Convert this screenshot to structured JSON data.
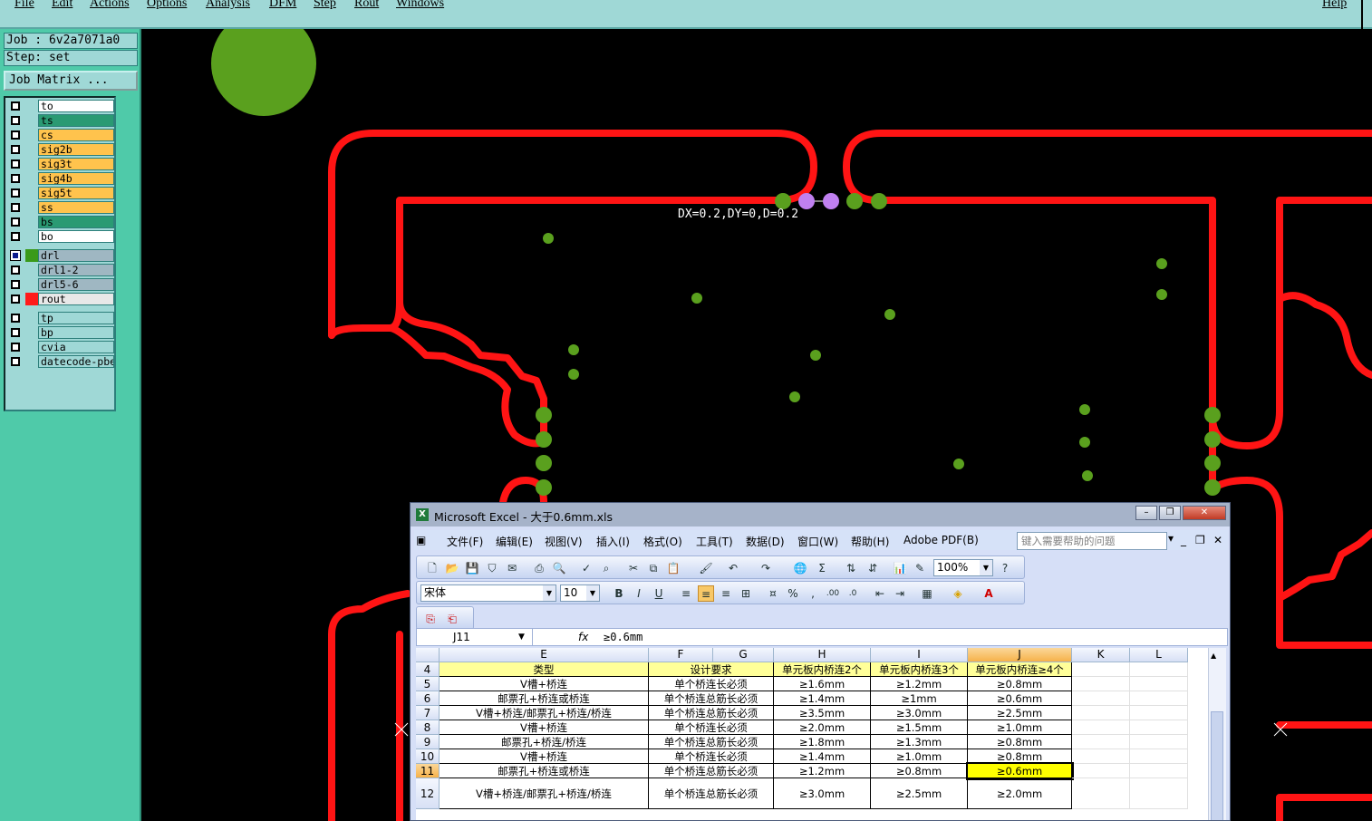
{
  "menubar": {
    "items": [
      "File",
      "Edit",
      "Actions",
      "Options",
      "Analysis",
      "DFM",
      "Step",
      "Rout",
      "Windows"
    ],
    "help": "Help"
  },
  "left_panel": {
    "job": "Job : 6v2a7071a0",
    "step": "Step: set",
    "job_matrix": "Job Matrix ...",
    "layers": [
      {
        "name": "to",
        "color": "#ffffff",
        "checked": false,
        "swatch": ""
      },
      {
        "name": "ts",
        "color": "#2a9a73",
        "checked": false,
        "swatch": ""
      },
      {
        "name": "cs",
        "color": "#ffc34d",
        "checked": false,
        "swatch": ""
      },
      {
        "name": "sig2b",
        "color": "#ffc34d",
        "checked": false,
        "swatch": ""
      },
      {
        "name": "sig3t",
        "color": "#ffc34d",
        "checked": false,
        "swatch": ""
      },
      {
        "name": "sig4b",
        "color": "#ffc34d",
        "checked": false,
        "swatch": ""
      },
      {
        "name": "sig5t",
        "color": "#ffc34d",
        "checked": false,
        "swatch": ""
      },
      {
        "name": "ss",
        "color": "#ffc34d",
        "checked": false,
        "swatch": ""
      },
      {
        "name": "bs",
        "color": "#2a9a73",
        "checked": false,
        "swatch": ""
      },
      {
        "name": "bo",
        "color": "#ffffff",
        "checked": false,
        "swatch": ""
      },
      {
        "name": "drl",
        "color": "#9fb7c2",
        "checked": true,
        "swatch": "#3a9a1a"
      },
      {
        "name": "drl1-2",
        "color": "#9fb7c2",
        "checked": false,
        "swatch": ""
      },
      {
        "name": "drl5-6",
        "color": "#9fb7c2",
        "checked": false,
        "swatch": ""
      },
      {
        "name": "rout",
        "color": "#e8e8e8",
        "checked": false,
        "swatch": "#ff1a1a"
      },
      {
        "name": "tp",
        "color": "#9fd8d6",
        "checked": false,
        "swatch": ""
      },
      {
        "name": "bp",
        "color": "#9fd8d6",
        "checked": false,
        "swatch": ""
      },
      {
        "name": "cvia",
        "color": "#9fd8d6",
        "checked": false,
        "swatch": ""
      },
      {
        "name": "datecode-pbe",
        "color": "#9fd8d6",
        "checked": false,
        "swatch": ""
      }
    ]
  },
  "canvas": {
    "measure_text": "DX=0.2,DY=0,D=0.2",
    "rout_color": "#ff1414",
    "drill_color": "#5aa01e",
    "measure_point_color": "#c080f0"
  },
  "excel": {
    "title": "Microsoft Excel - 大于0.6mm.xls",
    "menu": [
      "文件(F)",
      "编辑(E)",
      "视图(V)",
      "插入(I)",
      "格式(O)",
      "工具(T)",
      "数据(D)",
      "窗口(W)",
      "帮助(H)",
      "Adobe PDF(B)"
    ],
    "help_placeholder": "键入需要帮助的问题",
    "zoom": "100%",
    "font": "宋体",
    "font_size": "10",
    "name_box": "J11",
    "fx": "fx",
    "formula": "≥0.6mm",
    "columns": [
      "E",
      "F",
      "G",
      "H",
      "I",
      "J",
      "K",
      "L"
    ],
    "rows": [
      {
        "num": "4",
        "E": "类型",
        "F": "设计要求",
        "H": "单元板内桥连2个",
        "I": "单元板内桥连3个",
        "J": "单元板内桥连≥4个"
      },
      {
        "num": "5",
        "E": "V槽+桥连",
        "F": "单个桥连长必须",
        "H": "≥1.6mm",
        "I": "≥1.2mm",
        "J": "≥0.8mm"
      },
      {
        "num": "6",
        "E": "邮票孔+桥连或桥连",
        "F": "单个桥连总筋长必须",
        "H": "≥1.4mm",
        "I": "≥1mm",
        "J": "≥0.6mm"
      },
      {
        "num": "7",
        "E": "V槽+桥连/邮票孔+桥连/桥连",
        "F": "单个桥连总筋长必须",
        "H": "≥3.5mm",
        "I": "≥3.0mm",
        "J": "≥2.5mm"
      },
      {
        "num": "8",
        "E": "V槽+桥连",
        "F": "单个桥连长必须",
        "H": "≥2.0mm",
        "I": "≥1.5mm",
        "J": "≥1.0mm"
      },
      {
        "num": "9",
        "E": "邮票孔+桥连/桥连",
        "F": "单个桥连总筋长必须",
        "H": "≥1.8mm",
        "I": "≥1.3mm",
        "J": "≥0.8mm"
      },
      {
        "num": "10",
        "E": "V槽+桥连",
        "F": "单个桥连长必须",
        "H": "≥1.4mm",
        "I": "≥1.0mm",
        "J": "≥0.8mm"
      },
      {
        "num": "11",
        "E": "邮票孔+桥连或桥连",
        "F": "单个桥连总筋长必须",
        "H": "≥1.2mm",
        "I": "≥0.8mm",
        "J": "≥0.6mm"
      },
      {
        "num": "12",
        "E": "V槽+桥连/邮票孔+桥连/桥连",
        "F": "单个桥连总筋长必须",
        "H": "≥3.0mm",
        "I": "≥2.5mm",
        "J": "≥2.0mm"
      }
    ]
  }
}
